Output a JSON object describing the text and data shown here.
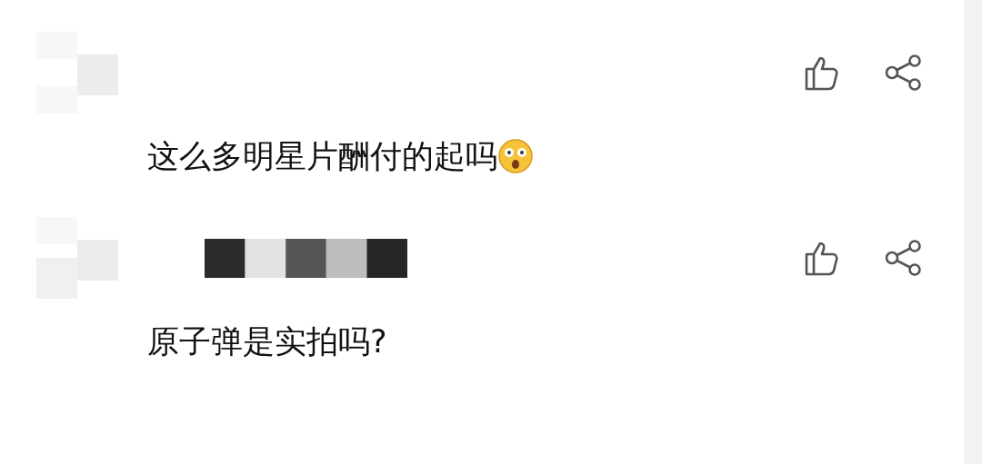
{
  "comments": [
    {
      "text": "这么多明星片酬付的起吗",
      "name_hidden": false,
      "emoji": true
    },
    {
      "text": "原子弹是实拍吗?",
      "name_hidden": true,
      "emoji": false
    }
  ]
}
